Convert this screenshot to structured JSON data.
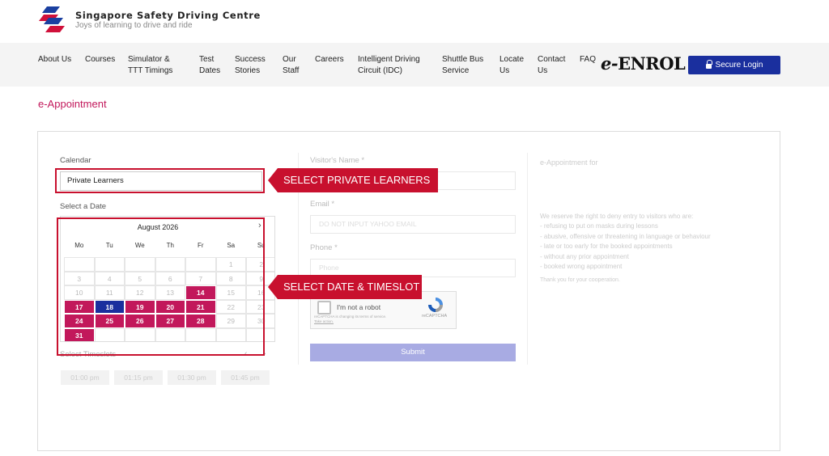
{
  "brand": {
    "name": "Singapore Safety Driving Centre",
    "tagline": "Joys of learning to drive and ride",
    "colors": {
      "logo_red": "#d0103a",
      "logo_blue": "#1a3fa0"
    }
  },
  "nav": {
    "items": [
      {
        "label": "About Us"
      },
      {
        "label": "Courses"
      },
      {
        "label": "Simulator &\nTTT Timings"
      },
      {
        "label": "Test\nDates"
      },
      {
        "label": "Success\nStories"
      },
      {
        "label": "Our\nStaff"
      },
      {
        "label": "Careers"
      },
      {
        "label": "Intelligent Driving\nCircuit (IDC)"
      },
      {
        "label": "Shuttle Bus\nService"
      },
      {
        "label": "Locate\nUs"
      },
      {
        "label": "Contact\nUs"
      },
      {
        "label": "FAQ"
      }
    ],
    "enrol_prefix": "e-",
    "enrol_suffix": "ENROL",
    "login_label": "Secure Login",
    "login_icon": "lock-icon",
    "login_color": "#1a2f9e"
  },
  "page": {
    "title": "e-Appointment",
    "accent": "#c2185b"
  },
  "form": {
    "calendar_label": "Calendar",
    "calendar_value": "Private Learners",
    "date_label": "Select a Date",
    "calendar": {
      "month": "August 2026",
      "next_icon": "chevron-right-icon",
      "weekdays": [
        "Mo",
        "Tu",
        "We",
        "Th",
        "Fr",
        "Sa",
        "Su"
      ],
      "weeks": [
        [
          {
            "d": ""
          },
          {
            "d": ""
          },
          {
            "d": ""
          },
          {
            "d": ""
          },
          {
            "d": ""
          },
          {
            "d": "1"
          },
          {
            "d": "2"
          }
        ],
        [
          {
            "d": "3"
          },
          {
            "d": "4"
          },
          {
            "d": "5"
          },
          {
            "d": "6"
          },
          {
            "d": "7"
          },
          {
            "d": "8"
          },
          {
            "d": "9"
          }
        ],
        [
          {
            "d": "10"
          },
          {
            "d": "11"
          },
          {
            "d": "12"
          },
          {
            "d": "13"
          },
          {
            "d": "14",
            "s": "avail"
          },
          {
            "d": "15"
          },
          {
            "d": "16"
          }
        ],
        [
          {
            "d": "17",
            "s": "avail"
          },
          {
            "d": "18",
            "s": "sel"
          },
          {
            "d": "19",
            "s": "avail"
          },
          {
            "d": "20",
            "s": "avail"
          },
          {
            "d": "21",
            "s": "avail"
          },
          {
            "d": "22"
          },
          {
            "d": "23"
          }
        ],
        [
          {
            "d": "24",
            "s": "avail"
          },
          {
            "d": "25",
            "s": "avail"
          },
          {
            "d": "26",
            "s": "avail"
          },
          {
            "d": "27",
            "s": "avail"
          },
          {
            "d": "28",
            "s": "avail"
          },
          {
            "d": "29"
          },
          {
            "d": "30"
          }
        ],
        [
          {
            "d": "31",
            "s": "avail"
          },
          {
            "d": ""
          },
          {
            "d": ""
          },
          {
            "d": ""
          },
          {
            "d": ""
          },
          {
            "d": ""
          },
          {
            "d": ""
          }
        ]
      ],
      "available_color": "#c2185b",
      "selected_color": "#1a2f9e"
    },
    "timeslot_label": "Select Timeslots",
    "timeslot_prev": "‹",
    "timeslot_next": "›",
    "timeslots": [
      "01:00 pm",
      "01:15 pm",
      "01:30 pm",
      "01:45 pm"
    ],
    "visitor_name_label": "Visitor's Name *",
    "email_label": "Email *",
    "email_placeholder": "DO NOT INPUT YAHOO EMAIL",
    "phone_label": "Phone *",
    "phone_placeholder": "Phone",
    "captcha": {
      "text": "I'm not a robot",
      "brand": "reCAPTCHA",
      "small_text": "reCAPTCHA is changing its terms of service.",
      "small_link": "Take action."
    },
    "submit_label": "Submit",
    "submit_color": "#a8abe3"
  },
  "info": {
    "title": "e-Appointment for",
    "lines": [
      "We reserve the right to deny entry to visitors who are:",
      "- refusing to put on masks during lessons",
      "- abusive, offensive or threatening in language or behaviour",
      "- late or too early for the booked appointments",
      "- without any prior appointment",
      "- booked wrong appointment"
    ],
    "thanks": "Thank you for your cooperation."
  },
  "annotations": [
    {
      "text": "SELECT PRIVATE LEARNERS",
      "color": "#c8102e"
    },
    {
      "text": "SELECT DATE & TIMESLOT",
      "color": "#c8102e"
    }
  ]
}
